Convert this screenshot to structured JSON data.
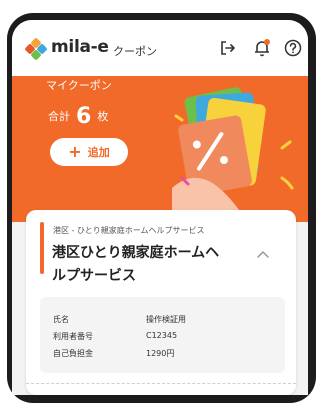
{
  "header": {
    "brand": "mila-e",
    "subtitle": "クーポン",
    "icons": [
      "logout-icon",
      "notification-bell-icon",
      "help-icon"
    ],
    "logo_colors": [
      "#f7a23a",
      "#e6592d",
      "#3fa9df",
      "#6cc04a"
    ]
  },
  "hero": {
    "title": "マイクーポン",
    "total_prefix": "合計",
    "total_count": "6",
    "total_unit": "枚",
    "add_label": "追加",
    "background": "#f26a2a"
  },
  "coupon": {
    "category": "港区 - ひとり親家庭ホームヘルプサービス",
    "title": "港区ひとり親家庭ホームヘルプサービス",
    "details": [
      {
        "label": "氏名",
        "value": "操作検証用"
      },
      {
        "label": "利用者番号",
        "value": "C12345"
      },
      {
        "label": "自己負担金",
        "value": "1290円"
      }
    ]
  }
}
